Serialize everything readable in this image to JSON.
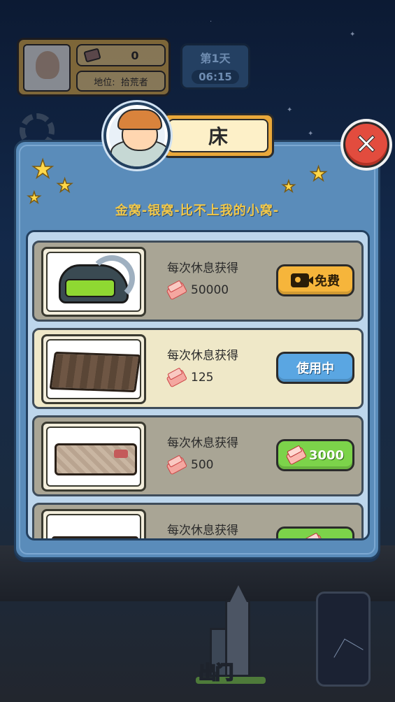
{
  "hud": {
    "resource_count": "0",
    "status_label": "地位:",
    "status_value": "拾荒者",
    "day": "第1天",
    "time": "06:15",
    "exit_label": "出门"
  },
  "dialog": {
    "title": "床",
    "subtitle": "金窝-银窝-比不上我的小窝-"
  },
  "beds": [
    {
      "label": "每次休息获得",
      "value": "50000",
      "button": "免费",
      "button_type": "video",
      "state": "locked"
    },
    {
      "label": "每次休息获得",
      "value": "125",
      "button": "使用中",
      "button_type": "inuse",
      "state": "active"
    },
    {
      "label": "每次休息获得",
      "value": "500",
      "button": "3000",
      "button_type": "buy",
      "state": "locked"
    },
    {
      "label": "每次休息获得",
      "value": "",
      "button": "",
      "button_type": "buy",
      "state": "locked"
    }
  ],
  "colors": {
    "panel": "#5a8cba",
    "list_bg": "#bdd6ec",
    "free_button": "#f6b53b",
    "inuse_button": "#5aa6e2",
    "buy_button": "#7cd34a",
    "close_button": "#e24c3e",
    "subtitle": "#f1c84a"
  },
  "icons": {
    "close": "close-icon",
    "video": "video-icon",
    "brick": "brick-icon",
    "star": "star-icon"
  }
}
